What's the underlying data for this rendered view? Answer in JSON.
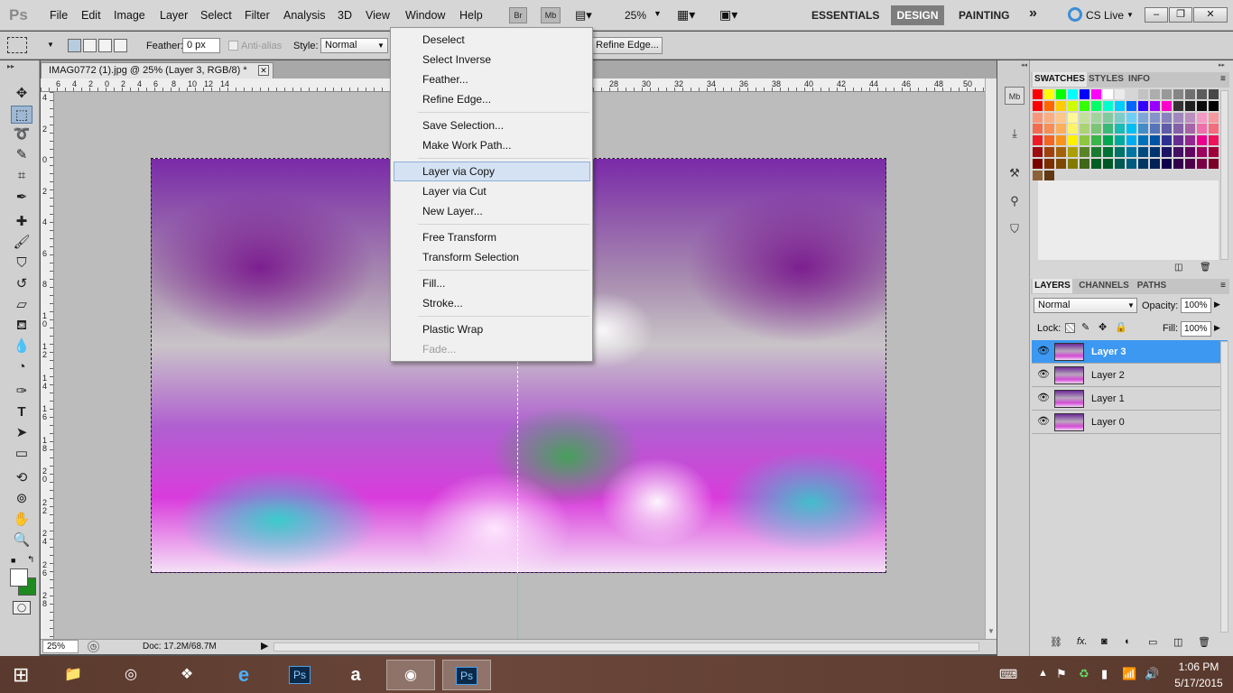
{
  "app": {
    "logo": "Ps"
  },
  "menubar": {
    "items": [
      "File",
      "Edit",
      "Image",
      "Layer",
      "Select",
      "Filter",
      "Analysis",
      "3D",
      "View",
      "Window",
      "Help"
    ],
    "bridge_label": "Br",
    "minibridge_label": "Mb",
    "zoom": "25%",
    "workspaces": {
      "essentials": "ESSENTIALS",
      "design": "DESIGN",
      "painting": "PAINTING",
      "more": "»"
    },
    "cslive": "CS Live"
  },
  "options": {
    "feather_label": "Feather:",
    "feather_value": "0 px",
    "antialias_label": "Anti-alias",
    "style_label": "Style:",
    "style_value": "Normal",
    "refine_edge": "Refine Edge..."
  },
  "document": {
    "tab_title": "IMAG0772 (1).jpg @ 25% (Layer 3, RGB/8) *",
    "ruler_h_ticks": [
      "6",
      "4",
      "2",
      "0",
      "2",
      "4",
      "6",
      "8",
      "10",
      "12",
      "14",
      "28",
      "30",
      "32",
      "34",
      "36",
      "38",
      "40",
      "42",
      "44",
      "46",
      "48",
      "50"
    ],
    "ruler_v_ticks": [
      "4",
      "2",
      "0",
      "2",
      "4",
      "6",
      "8",
      "1 0",
      "1 2",
      "1 4",
      "1 6",
      "1 8",
      "2 0",
      "2 2",
      "2 4",
      "2 6",
      "2 8"
    ],
    "status_zoom": "25%",
    "status_doc": "Doc: 17.2M/68.7M"
  },
  "select_menu": {
    "groups": [
      [
        "Deselect",
        "Select Inverse",
        "Feather...",
        "Refine Edge..."
      ],
      [
        "Save Selection...",
        "Make Work Path..."
      ],
      [
        "Layer via Copy",
        "Layer via Cut",
        "New Layer..."
      ],
      [
        "Free Transform",
        "Transform Selection"
      ],
      [
        "Fill...",
        "Stroke..."
      ],
      [
        "Plastic Wrap",
        "Fade..."
      ]
    ],
    "highlighted": "Layer via Copy",
    "disabled": [
      "Fade..."
    ]
  },
  "swatches_panel": {
    "tabs": [
      "SWATCHES",
      "STYLES",
      "INFO"
    ],
    "colors": [
      "#ff0000",
      "#ffff00",
      "#00ff00",
      "#00ffff",
      "#0000ff",
      "#ff00ff",
      "#ffffff",
      "#ebebeb",
      "#d6d6d6",
      "#c2c2c2",
      "#adadad",
      "#999999",
      "#858585",
      "#707070",
      "#5c5c5c",
      "#474747",
      "#ff0000",
      "#ff6600",
      "#ffcc00",
      "#ccff00",
      "#33ff00",
      "#00ff66",
      "#00ffcc",
      "#00ccff",
      "#0066ff",
      "#3300ff",
      "#9900ff",
      "#ff00cc",
      "#333333",
      "#1f1f1f",
      "#0a0a0a",
      "#000000",
      "#f7977a",
      "#f9ad81",
      "#fdc68a",
      "#fff79a",
      "#c4df9b",
      "#a3d39c",
      "#82ca9d",
      "#7bcdc8",
      "#6ecff6",
      "#7ea7d8",
      "#8493ca",
      "#8882be",
      "#a187be",
      "#bc8dbf",
      "#f49ac2",
      "#f6989d",
      "#f26c4f",
      "#f68e55",
      "#fbaf5c",
      "#fff467",
      "#acd372",
      "#7cc576",
      "#3bb878",
      "#1abbb4",
      "#00bff3",
      "#438cca",
      "#5574b9",
      "#605ca8",
      "#855fa8",
      "#a763a8",
      "#f06ea9",
      "#f26d7d",
      "#ed1c24",
      "#f26522",
      "#f7941d",
      "#fff200",
      "#8dc73f",
      "#39b54a",
      "#00a651",
      "#00a99d",
      "#00aeef",
      "#0072bc",
      "#0054a6",
      "#2e3192",
      "#662d91",
      "#92278f",
      "#ec008c",
      "#ed145b",
      "#9e0b0f",
      "#a0410d",
      "#a3620a",
      "#aba000",
      "#598527",
      "#1a7b30",
      "#007236",
      "#00746b",
      "#0076a3",
      "#004b80",
      "#003471",
      "#1b1464",
      "#440e62",
      "#630460",
      "#9e005d",
      "#9e0039",
      "#790000",
      "#7b2e00",
      "#7d4900",
      "#827b00",
      "#406618",
      "#005e20",
      "#005826",
      "#005952",
      "#005b7f",
      "#003663",
      "#002157",
      "#0d004c",
      "#32004b",
      "#4b0049",
      "#7b0046",
      "#7a0026",
      "#8c6239",
      "#603913"
    ]
  },
  "layers_panel": {
    "tabs": [
      "LAYERS",
      "CHANNELS",
      "PATHS"
    ],
    "blend_mode": "Normal",
    "opacity_label": "Opacity:",
    "opacity_value": "100%",
    "lock_label": "Lock:",
    "fill_label": "Fill:",
    "fill_value": "100%",
    "layers": [
      {
        "name": "Layer 3",
        "selected": true
      },
      {
        "name": "Layer 2",
        "selected": false
      },
      {
        "name": "Layer 1",
        "selected": false
      },
      {
        "name": "Layer 0",
        "selected": false
      }
    ]
  },
  "taskbar": {
    "clock_time": "1:06 PM",
    "clock_date": "5/17/2015"
  }
}
